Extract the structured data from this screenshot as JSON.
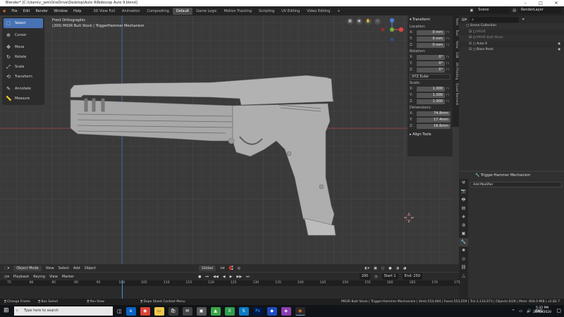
{
  "window": {
    "title": "Blender* [C:\\Users\\c_jam\\OneDrive\\Desktop\\Auto 9\\Robocop Auto 9.blend]"
  },
  "menu": [
    "File",
    "Edit",
    "Render",
    "Window",
    "Help"
  ],
  "workspaces": [
    "3D View Full",
    "Animation",
    "Compositing",
    "Default",
    "Game Logic",
    "Motion Tracking",
    "Scripting",
    "UV Editing",
    "Video Editing"
  ],
  "active_workspace": "Default",
  "scene": {
    "label": "Scene",
    "render_layer": "RenderLayer"
  },
  "tools": [
    "Select",
    "Cursor",
    "Move",
    "Rotate",
    "Scale",
    "Transform",
    "Annotate",
    "Measure"
  ],
  "viewport": {
    "view": "Front Orthographic",
    "info": "(200) M93R Butt Stock | TriggerHammer Mechanism"
  },
  "npanel": {
    "header": "Transform",
    "location_label": "Location:",
    "location": [
      "0 mm",
      "0 mm",
      "0 mm"
    ],
    "rotation_label": "Rotation:",
    "rotation": [
      "0°",
      "0°",
      "0°"
    ],
    "rotation_mode": "XYZ Euler",
    "scale_label": "Scale:",
    "scale": [
      "1.000",
      "1.000",
      "1.000"
    ],
    "dimensions_label": "Dimensions:",
    "dimensions": [
      "74.8mm",
      "17.4mm",
      "16.6mm"
    ],
    "axes": [
      "X:",
      "Y:",
      "Z:"
    ],
    "align_tools": "Align Tools",
    "tabs": [
      "Item",
      "Tool",
      "View",
      "Edit",
      "3D-Printing",
      "Quad Remesh"
    ]
  },
  "outliner": {
    "items": [
      "Scene Collection",
      "M93R",
      "M93R Butt Stock",
      "Auto 9",
      "Base Parts"
    ]
  },
  "properties": {
    "object": "Trigger-Hammer Mechanism",
    "add_modifier": "Add Modifier"
  },
  "viewport_header": {
    "mode": "Object Mode",
    "menus": [
      "View",
      "Select",
      "Add",
      "Object"
    ],
    "orientation": "Global"
  },
  "timeline": {
    "menus": [
      "Playback",
      "Keying",
      "View",
      "Marker"
    ],
    "current_frame": "200",
    "start_label": "Start",
    "start": "1",
    "end_label": "End",
    "end": "250",
    "ticks": [
      "75",
      "80",
      "85",
      "90",
      "95",
      "100",
      "105",
      "110",
      "115",
      "120",
      "125",
      "130",
      "135",
      "140",
      "145",
      "150",
      "155",
      "160",
      "165",
      "170",
      "175"
    ]
  },
  "status": {
    "change_frame": "Change Frame",
    "box_select": "Box Select",
    "pan_view": "Pan View",
    "context_menu": "Dope Sheet Context Menu",
    "stats": "M93R Butt Stock | Trigger-Hammer Mechanism | Verts:554,694 | Faces:553,659 | Tris:1,110,973 | Objects:0/26 | Mem: 604.0 MiB | v2.82.7"
  },
  "taskbar": {
    "search_placeholder": "Type here to search",
    "lang": "ENG",
    "time": "5:32 PM",
    "date": "20/02/2020"
  }
}
